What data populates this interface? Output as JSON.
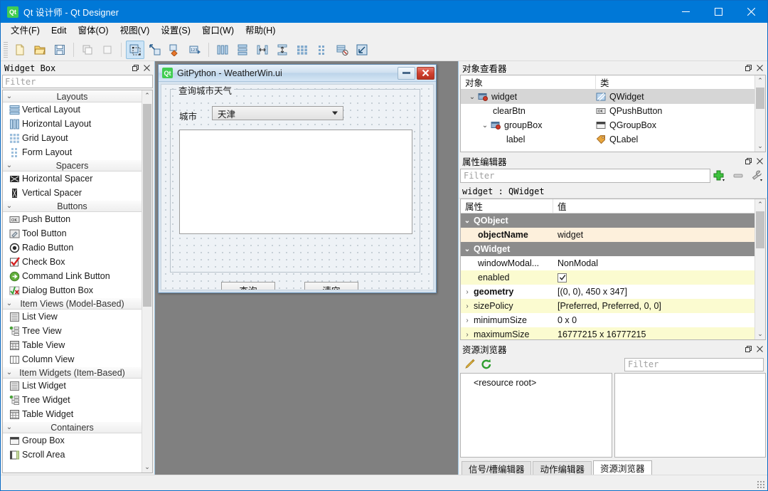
{
  "window": {
    "title": "Qt 设计师 - Qt Designer",
    "app_icon": "qt-logo-icon",
    "minimize_label": "minimize",
    "maximize_label": "maximize",
    "close_label": "close"
  },
  "menubar": {
    "items": [
      {
        "label": "文件(F)",
        "name": "menu-file"
      },
      {
        "label": "Edit",
        "name": "menu-edit"
      },
      {
        "label": "窗体(O)",
        "name": "menu-form"
      },
      {
        "label": "视图(V)",
        "name": "menu-view"
      },
      {
        "label": "设置(S)",
        "name": "menu-settings"
      },
      {
        "label": "窗口(W)",
        "name": "menu-window"
      },
      {
        "label": "帮助(H)",
        "name": "menu-help"
      }
    ]
  },
  "toolbar": {
    "groups": [
      {
        "buttons": [
          {
            "name": "new-form-button",
            "icon": "new-document-icon"
          },
          {
            "name": "open-form-button",
            "icon": "open-folder-icon"
          },
          {
            "name": "save-form-button",
            "icon": "save-disk-icon"
          }
        ]
      },
      {
        "buttons": [
          {
            "name": "undo-button",
            "icon": "undo-icon"
          },
          {
            "name": "redo-button",
            "icon": "redo-icon"
          }
        ]
      },
      {
        "buttons": [
          {
            "name": "edit-widgets-button",
            "icon": "edit-widgets-icon",
            "active": true
          },
          {
            "name": "edit-signals-slots-button",
            "icon": "signals-slots-icon",
            "active": false
          },
          {
            "name": "edit-buddies-button",
            "icon": "buddies-icon",
            "active": false
          },
          {
            "name": "edit-tab-order-button",
            "icon": "tab-order-icon",
            "active": false
          }
        ]
      },
      {
        "buttons": [
          {
            "name": "layout-horizontally-button",
            "icon": "layout-horizontal-icon"
          },
          {
            "name": "layout-vertically-button",
            "icon": "layout-vertical-icon"
          },
          {
            "name": "layout-splitter-horizontal-button",
            "icon": "splitter-horizontal-icon"
          },
          {
            "name": "layout-splitter-vertical-button",
            "icon": "splitter-vertical-icon"
          },
          {
            "name": "layout-grid-button",
            "icon": "grid-layout-icon"
          },
          {
            "name": "layout-form-button",
            "icon": "form-layout-icon"
          },
          {
            "name": "break-layout-button",
            "icon": "break-layout-icon"
          },
          {
            "name": "adjust-size-button",
            "icon": "adjust-size-icon"
          }
        ]
      }
    ]
  },
  "widget_box": {
    "title": "Widget Box",
    "filter_placeholder": "Filter",
    "float_label": "float",
    "close_label": "close",
    "sections": [
      {
        "name": "Layouts",
        "items": [
          {
            "label": "Vertical Layout",
            "icon": "vertical-layout-icon"
          },
          {
            "label": "Horizontal Layout",
            "icon": "horizontal-layout-icon"
          },
          {
            "label": "Grid Layout",
            "icon": "grid-layout-icon"
          },
          {
            "label": "Form Layout",
            "icon": "form-layout-icon"
          }
        ]
      },
      {
        "name": "Spacers",
        "items": [
          {
            "label": "Horizontal Spacer",
            "icon": "horizontal-spacer-icon"
          },
          {
            "label": "Vertical Spacer",
            "icon": "vertical-spacer-icon"
          }
        ]
      },
      {
        "name": "Buttons",
        "items": [
          {
            "label": "Push Button",
            "icon": "push-button-icon"
          },
          {
            "label": "Tool Button",
            "icon": "tool-button-icon"
          },
          {
            "label": "Radio Button",
            "icon": "radio-button-icon"
          },
          {
            "label": "Check Box",
            "icon": "check-box-icon"
          },
          {
            "label": "Command Link Button",
            "icon": "command-link-icon"
          },
          {
            "label": "Dialog Button Box",
            "icon": "dialog-button-box-icon"
          }
        ]
      },
      {
        "name": "Item Views (Model-Based)",
        "items": [
          {
            "label": "List View",
            "icon": "list-view-icon"
          },
          {
            "label": "Tree View",
            "icon": "tree-view-icon"
          },
          {
            "label": "Table View",
            "icon": "table-view-icon"
          },
          {
            "label": "Column View",
            "icon": "column-view-icon"
          }
        ]
      },
      {
        "name": "Item Widgets (Item-Based)",
        "items": [
          {
            "label": "List Widget",
            "icon": "list-widget-icon"
          },
          {
            "label": "Tree Widget",
            "icon": "tree-widget-icon"
          },
          {
            "label": "Table Widget",
            "icon": "table-widget-icon"
          }
        ]
      },
      {
        "name": "Containers",
        "items": [
          {
            "label": "Group Box",
            "icon": "group-box-icon"
          },
          {
            "label": "Scroll Area",
            "icon": "scroll-area-icon"
          }
        ]
      }
    ]
  },
  "form_window": {
    "title": "GitPython - WeatherWin.ui",
    "icon": "qt-logo-icon",
    "minimize_label": "minimize",
    "close_label": "close",
    "group_box_title": "查询城市天气",
    "city_label": "城市",
    "city_combo_value": "天津",
    "result_textedit_value": "",
    "buttons": [
      {
        "label": "查询",
        "name": "query-button"
      },
      {
        "label": "清空",
        "name": "clear-button"
      }
    ]
  },
  "object_inspector": {
    "title": "对象查看器",
    "columns": [
      "对象",
      "类"
    ],
    "rows": [
      {
        "object": "widget",
        "class": "QWidget",
        "indent": 0,
        "expander": "v",
        "icon": "qwidget-icon",
        "selected": true
      },
      {
        "object": "clearBtn",
        "class": "QPushButton",
        "indent": 1,
        "expander": "",
        "icon": "qpushbutton-icon",
        "selected": false
      },
      {
        "object": "groupBox",
        "class": "QGroupBox",
        "indent": 1,
        "expander": "v",
        "icon": "qgroupbox-icon",
        "selected": false
      },
      {
        "object": "label",
        "class": "QLabel",
        "indent": 2,
        "expander": "",
        "icon": "qlabel-icon",
        "selected": false
      }
    ]
  },
  "property_editor": {
    "title": "属性编辑器",
    "filter_placeholder": "Filter",
    "add_button": "add-property-button",
    "remove_button": "remove-property-button",
    "configure_button": "configure-button",
    "object_header": "widget : QWidget",
    "columns": [
      "属性",
      "值"
    ],
    "rows": [
      {
        "kind": "group",
        "name": "QObject",
        "value": ""
      },
      {
        "kind": "prop",
        "name": "objectName",
        "value": "widget",
        "bold": true,
        "expander": false,
        "shade": "a"
      },
      {
        "kind": "group",
        "name": "QWidget",
        "value": ""
      },
      {
        "kind": "prop",
        "name": "windowModal...",
        "value": "NonModal",
        "bold": false,
        "expander": false,
        "shade": "none"
      },
      {
        "kind": "prop",
        "name": "enabled",
        "value": "checkbox-checked",
        "bold": false,
        "expander": false,
        "shade": "b"
      },
      {
        "kind": "prop",
        "name": "geometry",
        "value": "[(0, 0), 450 x 347]",
        "bold": true,
        "expander": true,
        "shade": "none"
      },
      {
        "kind": "prop",
        "name": "sizePolicy",
        "value": "[Preferred, Preferred, 0, 0]",
        "bold": false,
        "expander": true,
        "shade": "b"
      },
      {
        "kind": "prop",
        "name": "minimumSize",
        "value": "0 x 0",
        "bold": false,
        "expander": true,
        "shade": "none"
      },
      {
        "kind": "prop",
        "name": "maximumSize",
        "value": "16777215 x 16777215",
        "bold": false,
        "expander": true,
        "shade": "b"
      }
    ]
  },
  "resource_browser": {
    "title": "资源浏览器",
    "edit_button": "edit-resources-button",
    "reload_button": "reload-resources-button",
    "filter_placeholder": "Filter",
    "resource_root": "<resource root>",
    "tabs": [
      {
        "label": "信号/槽编辑器",
        "active": false
      },
      {
        "label": "动作编辑器",
        "active": false
      },
      {
        "label": "资源浏览器",
        "active": true
      }
    ]
  },
  "colors": {
    "titlebar": "#0078d7",
    "accent_selected": "#d6d6d6",
    "prop_group": "#8c8c8c",
    "prop_row_a": "#fdf0dc",
    "prop_row_b": "#fbfbd0",
    "canvas_bg": "#808080",
    "qt_green": "#41cd52"
  }
}
